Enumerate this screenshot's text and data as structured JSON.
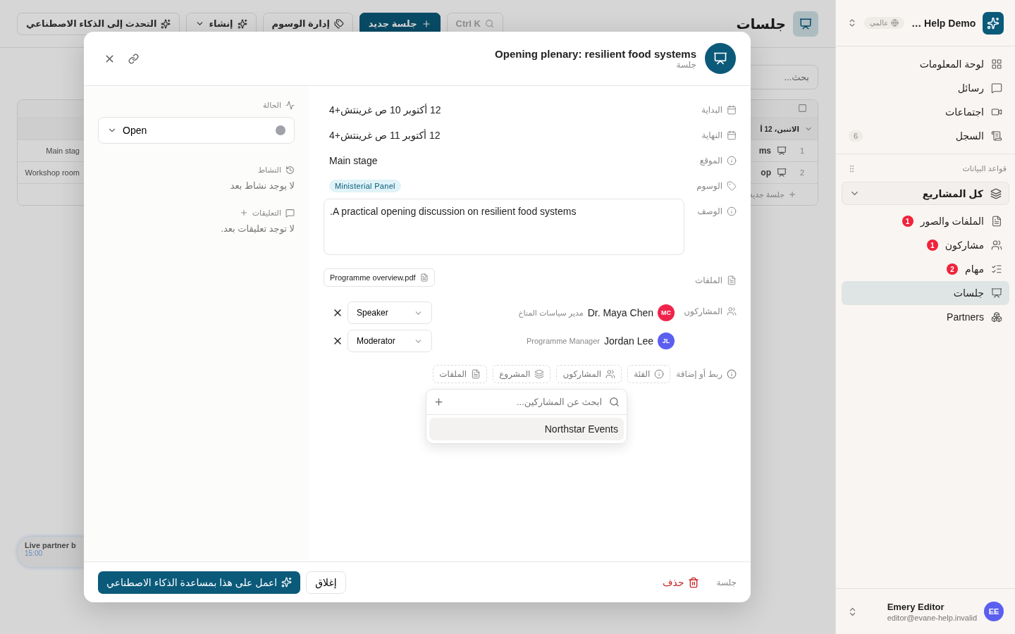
{
  "page": {
    "title": "جلسات",
    "toolbar": [
      {
        "kind": "search",
        "label": "Ctrl K"
      },
      {
        "kind": "primary",
        "label": "جلسة جديد"
      },
      {
        "kind": "tags",
        "label": "إدارة الوسوم"
      },
      {
        "kind": "menu",
        "label": "إنشاء"
      },
      {
        "kind": "ai",
        "label": "التحدث إلى الذكاء الاصطناعي"
      }
    ],
    "search": {
      "placeholder": "بحث..."
    },
    "table": {
      "select_all": {
        "checked": false
      },
      "group": "الاثنين، 12 أ",
      "rows": [
        {
          "number": "1",
          "title": "ms",
          "location": "Main stag"
        },
        {
          "number": "2",
          "title": "op",
          "location": "Workshop room"
        }
      ],
      "add_label": "جلسة جديد"
    },
    "floating_event": {
      "title": "Live partner b",
      "time": "15:00"
    }
  },
  "modal": {
    "title": "Opening plenary: resilient food systems",
    "subtitle": "جلسة",
    "fields": [
      {
        "kind": "text",
        "label": "البداية",
        "value": "12 أكتوبر 10 ص غرينتش+4"
      },
      {
        "kind": "text",
        "label": "النهاية",
        "value": "12 أكتوبر 11 ص غرينتش+4"
      },
      {
        "kind": "text",
        "label": "الموقع",
        "value": "Main stage"
      },
      {
        "kind": "tags",
        "label": "الوسوم",
        "tags": [
          "Ministerial Panel"
        ]
      },
      {
        "kind": "description",
        "label": "الوصف",
        "value": "A practical opening discussion on resilient food systems."
      },
      {
        "kind": "files",
        "label": "الملفات",
        "files": [
          "Programme overview.pdf"
        ]
      },
      {
        "kind": "participants",
        "label": "المشاركون",
        "people": [
          {
            "initials": "MC",
            "name": "Dr. Maya Chen",
            "role": "مدير سياسات المناخ",
            "option": "Speaker",
            "color": "#f0234b"
          },
          {
            "initials": "JL",
            "name": "Jordan Lee",
            "role": "Programme Manager",
            "option": "Moderator",
            "color": "#5b5ff0"
          }
        ]
      }
    ],
    "links": {
      "label": "ربط أو إضافة",
      "chips": [
        "الفئة",
        "المشاركون",
        "المشروع",
        "الملفات"
      ]
    },
    "picker": {
      "placeholder": "ابحث عن المشاركين...",
      "options": [
        {
          "label": "Northstar Events",
          "selected": true
        }
      ]
    },
    "side": {
      "status": {
        "label": "الحالة",
        "value": "Open",
        "color": "#a1a1aa"
      },
      "activity": {
        "label": "النشاط",
        "empty": "لا يوجد نشاط بعد"
      },
      "comments": {
        "label": "التعليقات",
        "empty": "لا توجد تعليقات بعد."
      }
    },
    "footer": {
      "type": "جلسة",
      "delete": "حذف",
      "close": "إغلاق",
      "ai": "اعمل على هذا بمساعدة الذكاء الاصطناعي"
    }
  },
  "sidebar": {
    "workspace": "Help Demo …",
    "scope": "عالمي",
    "nav": [
      {
        "label": "لوحة المعلومات"
      },
      {
        "label": "رسائل"
      },
      {
        "label": "اجتماعات"
      },
      {
        "label": "السجل",
        "count": "6"
      }
    ],
    "section": "قواعد البيانات",
    "project_filter": "كل المشاريع",
    "databases": [
      {
        "label": "الملفات والصور",
        "badge": "1",
        "selected": false
      },
      {
        "label": "مشاركون",
        "badge": "1",
        "selected": false
      },
      {
        "label": "مهام",
        "badge": "2",
        "selected": false
      },
      {
        "label": "جلسات",
        "selected": true
      },
      {
        "label": "Partners",
        "selected": false
      }
    ],
    "user": {
      "initials": "EE",
      "name": "Emery Editor",
      "email": "editor@evane-help.invalid"
    }
  }
}
